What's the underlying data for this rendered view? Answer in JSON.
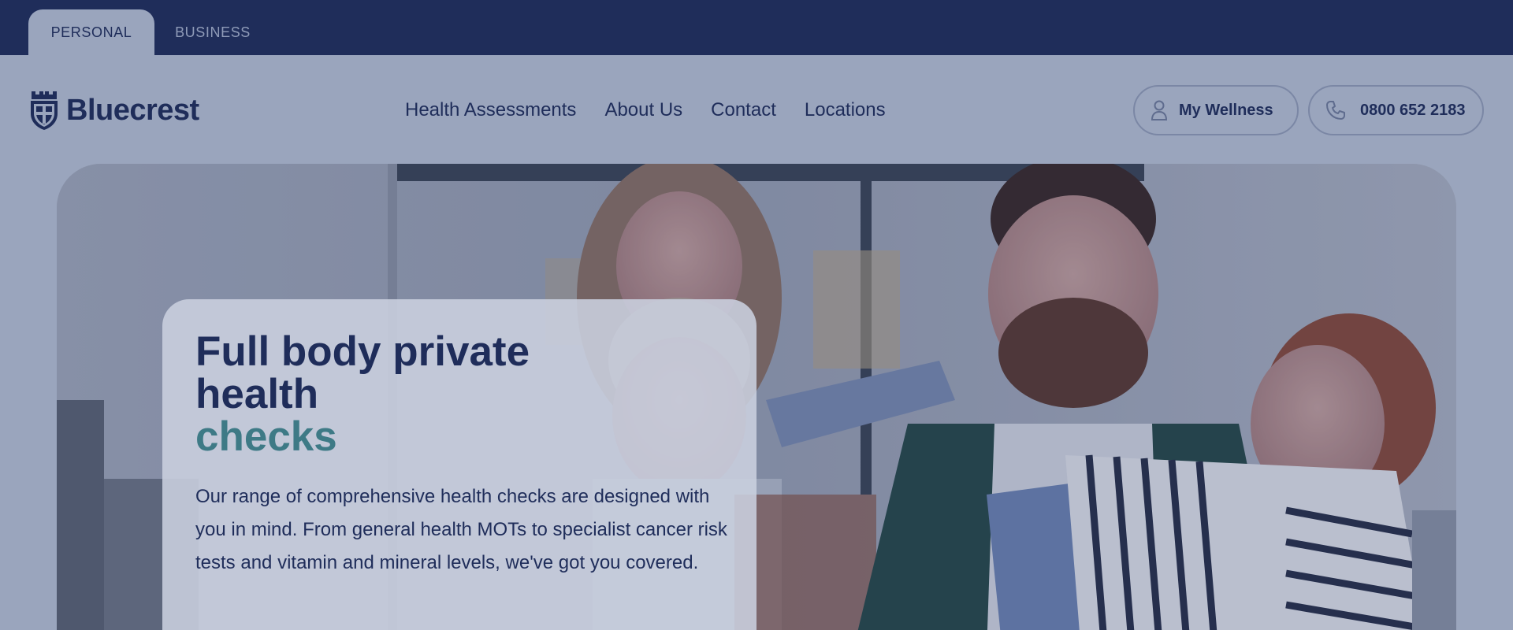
{
  "segments": {
    "personal_label": "PERSONAL",
    "business_label": "BUSINESS"
  },
  "brand": {
    "name": "Bluecrest",
    "logo_icon": "shield-cross-icon"
  },
  "nav": {
    "items": [
      {
        "label": "Health Assessments"
      },
      {
        "label": "About Us"
      },
      {
        "label": "Contact"
      },
      {
        "label": "Locations"
      }
    ]
  },
  "actions": {
    "wellness_label": "My Wellness",
    "wellness_icon": "user-icon",
    "phone_label": "0800 652 2183",
    "phone_icon": "phone-icon"
  },
  "hero": {
    "title_line1": "Full body private",
    "title_line2": "health",
    "title_accent": "checks",
    "description": "Our range of comprehensive health checks are designed with you in mind. From general health MOTs to specialist cancer risk tests and vitamin and mineral levels, we've got you covered."
  },
  "colors": {
    "navy": "#1f2d5a",
    "teal_accent": "#3e7a86",
    "overlay_bg": "#9aa5bd"
  }
}
